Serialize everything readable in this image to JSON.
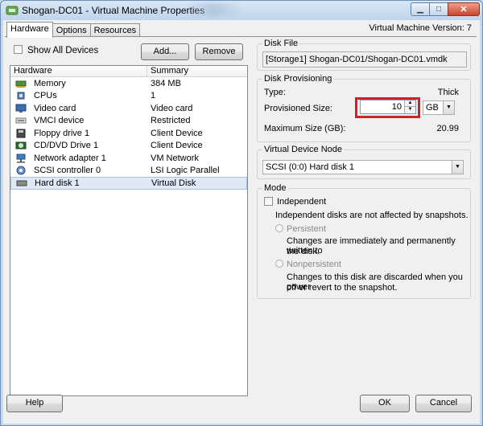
{
  "window": {
    "title": "Shogan-DC01 - Virtual Machine Properties"
  },
  "tabs": [
    {
      "label": "Hardware"
    },
    {
      "label": "Options"
    },
    {
      "label": "Resources"
    }
  ],
  "version_label": "Virtual Machine Version: 7",
  "show_all_devices": {
    "label": "Show All Devices",
    "checked": false
  },
  "buttons": {
    "add": "Add...",
    "remove": "Remove",
    "help": "Help",
    "ok": "OK",
    "cancel": "Cancel"
  },
  "hardware_table": {
    "headers": [
      "Hardware",
      "Summary"
    ],
    "rows": [
      {
        "name": "Memory",
        "summary": "384 MB",
        "icon": "memory-icon"
      },
      {
        "name": "CPUs",
        "summary": "1",
        "icon": "cpu-icon"
      },
      {
        "name": "Video card",
        "summary": "Video card",
        "icon": "video-card-icon"
      },
      {
        "name": "VMCI device",
        "summary": "Restricted",
        "icon": "vmci-device-icon"
      },
      {
        "name": "Floppy drive 1",
        "summary": "Client Device",
        "icon": "floppy-drive-icon"
      },
      {
        "name": "CD/DVD Drive 1",
        "summary": "Client Device",
        "icon": "cd-dvd-drive-icon"
      },
      {
        "name": "Network adapter 1",
        "summary": "VM Network",
        "icon": "network-adapter-icon"
      },
      {
        "name": "SCSI controller 0",
        "summary": "LSI Logic Parallel",
        "icon": "scsi-controller-icon"
      },
      {
        "name": "Hard disk 1",
        "summary": "Virtual Disk",
        "icon": "hard-disk-icon",
        "selected": true
      }
    ]
  },
  "disk_file": {
    "label": "Disk File",
    "path": "[Storage1] Shogan-DC01/Shogan-DC01.vmdk"
  },
  "disk_provisioning": {
    "label": "Disk Provisioning",
    "type_label": "Type:",
    "type_value": "Thick",
    "provisioned_label": "Provisioned Size:",
    "provisioned_value": "10",
    "unit": "GB",
    "max_label": "Maximum Size (GB):",
    "max_value": "20.99"
  },
  "virtual_device_node": {
    "label": "Virtual Device Node",
    "value": "SCSI (0:0) Hard disk 1"
  },
  "mode": {
    "label": "Mode",
    "independent_label": "Independent",
    "independent_desc": "Independent disks are not affected by snapshots.",
    "persistent_label": "Persistent",
    "persistent_desc_1": "Changes are immediately and permanently written to",
    "persistent_desc_2": "the disk.",
    "nonpersistent_label": "Nonpersistent",
    "nonpersistent_desc_1": "Changes to this disk are discarded when you power",
    "nonpersistent_desc_2": "off or revert to the snapshot."
  },
  "colors": {
    "highlight_box": "#d0212b",
    "selected_row": "#dfe8f5"
  }
}
